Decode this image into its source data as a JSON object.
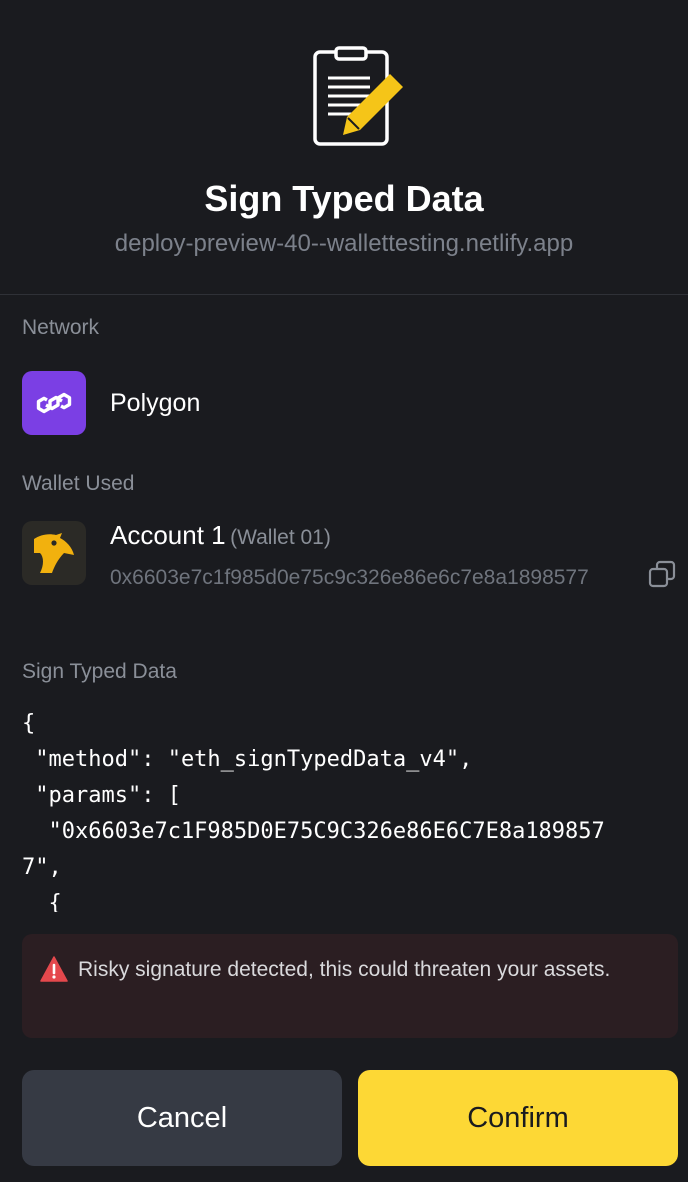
{
  "header": {
    "icon": "document-sign-icon",
    "title": "Sign Typed Data",
    "origin": "deploy-preview-40--wallettesting.netlify.app"
  },
  "network": {
    "label": "Network",
    "name": "Polygon",
    "icon": "polygon-logo-icon",
    "brand_color": "#7b3fe4"
  },
  "wallet": {
    "label": "Wallet Used",
    "account_name": "Account 1",
    "wallet_name": "(Wallet 01)",
    "address": "0x6603e7c1f985d0e75c9c326e86e6c7e8a1898577",
    "avatar_icon": "bird-avatar-icon",
    "copy_icon": "copy-icon"
  },
  "sign_data": {
    "label": "Sign Typed Data",
    "content": "{\n \"method\": \"eth_signTypedData_v4\",\n \"params\": [\n  \"0x6603e7c1F985D0E75C9C326e86E6C7E8a189857\n7\",\n  {"
  },
  "warning": {
    "icon": "warning-triangle-icon",
    "text": "Risky signature detected, this could threaten your assets.",
    "color": "#e5484d"
  },
  "actions": {
    "cancel_label": "Cancel",
    "confirm_label": "Confirm",
    "accent_color": "#fdd835"
  }
}
